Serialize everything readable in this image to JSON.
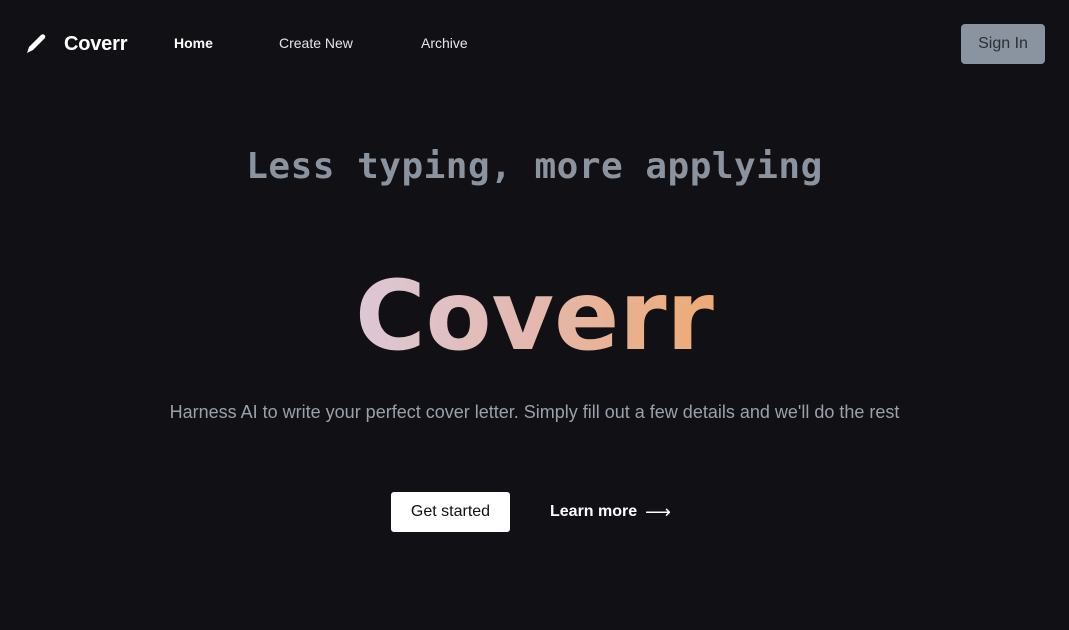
{
  "header": {
    "brand_name": "Coverr",
    "brand_icon": "pen-icon",
    "nav": [
      {
        "label": "Home",
        "active": true
      },
      {
        "label": "Create New",
        "active": false
      },
      {
        "label": "Archive",
        "active": false
      }
    ],
    "sign_in_label": "Sign In"
  },
  "hero": {
    "tagline": "Less typing, more applying",
    "title": "Coverr",
    "subtitle": "Harness AI to write your perfect cover letter. Simply fill out a few details and we'll do the rest",
    "primary_cta": "Get started",
    "secondary_cta": "Learn more",
    "secondary_cta_icon": "arrow-right-icon",
    "secondary_cta_arrow": "⟶"
  },
  "colors": {
    "background": "#111015",
    "tagline": "#8b939e",
    "gradient_start": "#dcc8d6",
    "gradient_end": "#eeaa74",
    "sign_in_bg": "#8a93a0"
  }
}
